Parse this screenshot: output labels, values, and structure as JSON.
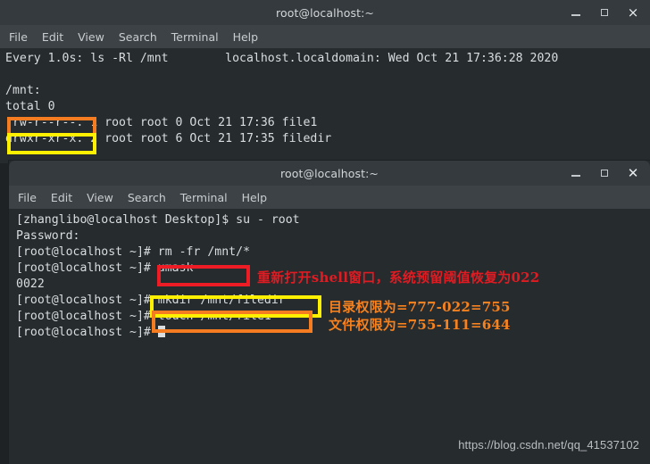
{
  "window1": {
    "title": "root@localhost:~",
    "menu": [
      "File",
      "Edit",
      "View",
      "Search",
      "Terminal",
      "Help"
    ],
    "controls": {
      "minimize": "minimize-icon",
      "maximize": "maximize-icon",
      "close": "×"
    },
    "lines": [
      "Every 1.0s: ls -Rl /mnt        localhost.localdomain: Wed Oct 21 17:36:28 2020",
      "",
      "/mnt:",
      "total 0",
      "-rw-r--r--. 1 root root 0 Oct 21 17:36 file1",
      "drwxr-xr-x. 2 root root 6 Oct 21 17:35 filedir"
    ]
  },
  "window2": {
    "title": "root@localhost:~",
    "menu": [
      "File",
      "Edit",
      "View",
      "Search",
      "Terminal",
      "Help"
    ],
    "controls": {
      "minimize": "minimize-icon",
      "maximize": "maximize-icon",
      "close": "✕"
    },
    "lines": [
      "[zhanglibo@localhost Desktop]$ su - root",
      "Password:",
      "[root@localhost ~]# rm -fr /mnt/*",
      "[root@localhost ~]# umask",
      "0022",
      "[root@localhost ~]# mkdir /mnt/filedir",
      "[root@localhost ~]# touch /mnt/file1",
      "[root@localhost ~]# "
    ]
  },
  "highlights": {
    "file_perm_label": "rw-r--r--",
    "dir_perm_label": "rwxr-xr-x",
    "umask_cmd": "umask",
    "mkdir_cmd": "mkdir /mnt/filedir",
    "touch_cmd": "touch /mnt/file1"
  },
  "annotations": {
    "reopen_shell": "重新打开shell窗口，系统预留阈值恢复为022",
    "dir_perm": "目录权限为=777-022=755",
    "file_perm": "文件权限为=755-111=644"
  },
  "watermark": "https://blog.csdn.net/qq_41537102",
  "colors": {
    "titlebar": "#343a3d",
    "menubar": "#3c4245",
    "terminal_bg": "#262b2e",
    "terminal_fg": "#d9dde0",
    "orange": "#f57c20",
    "yellow": "#ffef00",
    "red": "#ee1c25",
    "anno_red": "#e01b22",
    "anno_orange": "#f5821f"
  }
}
